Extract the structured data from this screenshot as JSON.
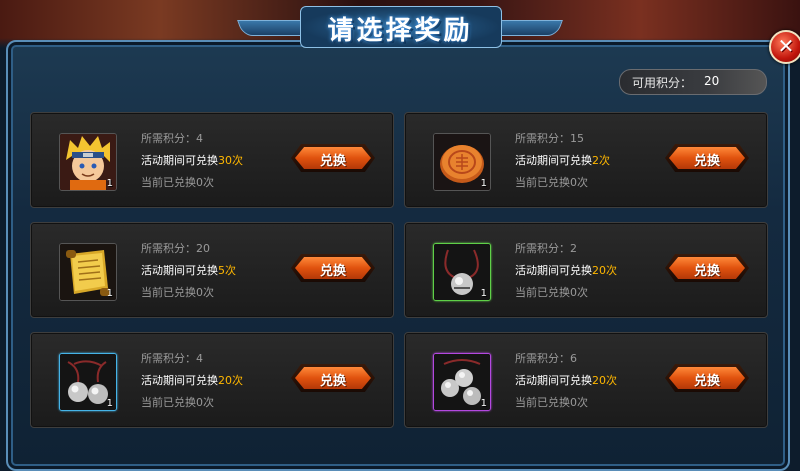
{
  "title": "请选择奖励",
  "close_icon": "close-x-icon",
  "points": {
    "label": "可用积分：",
    "value": "20"
  },
  "exchange_label": "兑换",
  "rewards": [
    {
      "icon": "naruto-portrait-icon",
      "quantity": "1",
      "border": "none",
      "cost": "所需积分：4",
      "limit_prefix": "活动期间可兑换",
      "limit_count": "30",
      "limit_suffix": "次",
      "exchanged": "当前已兑换0次"
    },
    {
      "icon": "mooncake-icon",
      "quantity": "1",
      "border": "none",
      "cost": "所需积分：15",
      "limit_prefix": "活动期间可兑换",
      "limit_count": "2",
      "limit_suffix": "次",
      "exchanged": "当前已兑换0次"
    },
    {
      "icon": "scroll-icon",
      "quantity": "1",
      "border": "none",
      "cost": "所需积分：20",
      "limit_prefix": "活动期间可兑换",
      "limit_count": "5",
      "limit_suffix": "次",
      "exchanged": "当前已兑换0次"
    },
    {
      "icon": "single-bell-icon",
      "quantity": "1",
      "border": "green",
      "cost": "所需积分：2",
      "limit_prefix": "活动期间可兑换",
      "limit_count": "20",
      "limit_suffix": "次",
      "exchanged": "当前已兑换0次"
    },
    {
      "icon": "double-bell-icon",
      "quantity": "1",
      "border": "blue",
      "cost": "所需积分：4",
      "limit_prefix": "活动期间可兑换",
      "limit_count": "20",
      "limit_suffix": "次",
      "exchanged": "当前已兑换0次"
    },
    {
      "icon": "triple-bell-icon",
      "quantity": "1",
      "border": "purple",
      "cost": "所需积分：6",
      "limit_prefix": "活动期间可兑换",
      "limit_count": "20",
      "limit_suffix": "次",
      "exchanged": "当前已兑换0次"
    }
  ]
}
